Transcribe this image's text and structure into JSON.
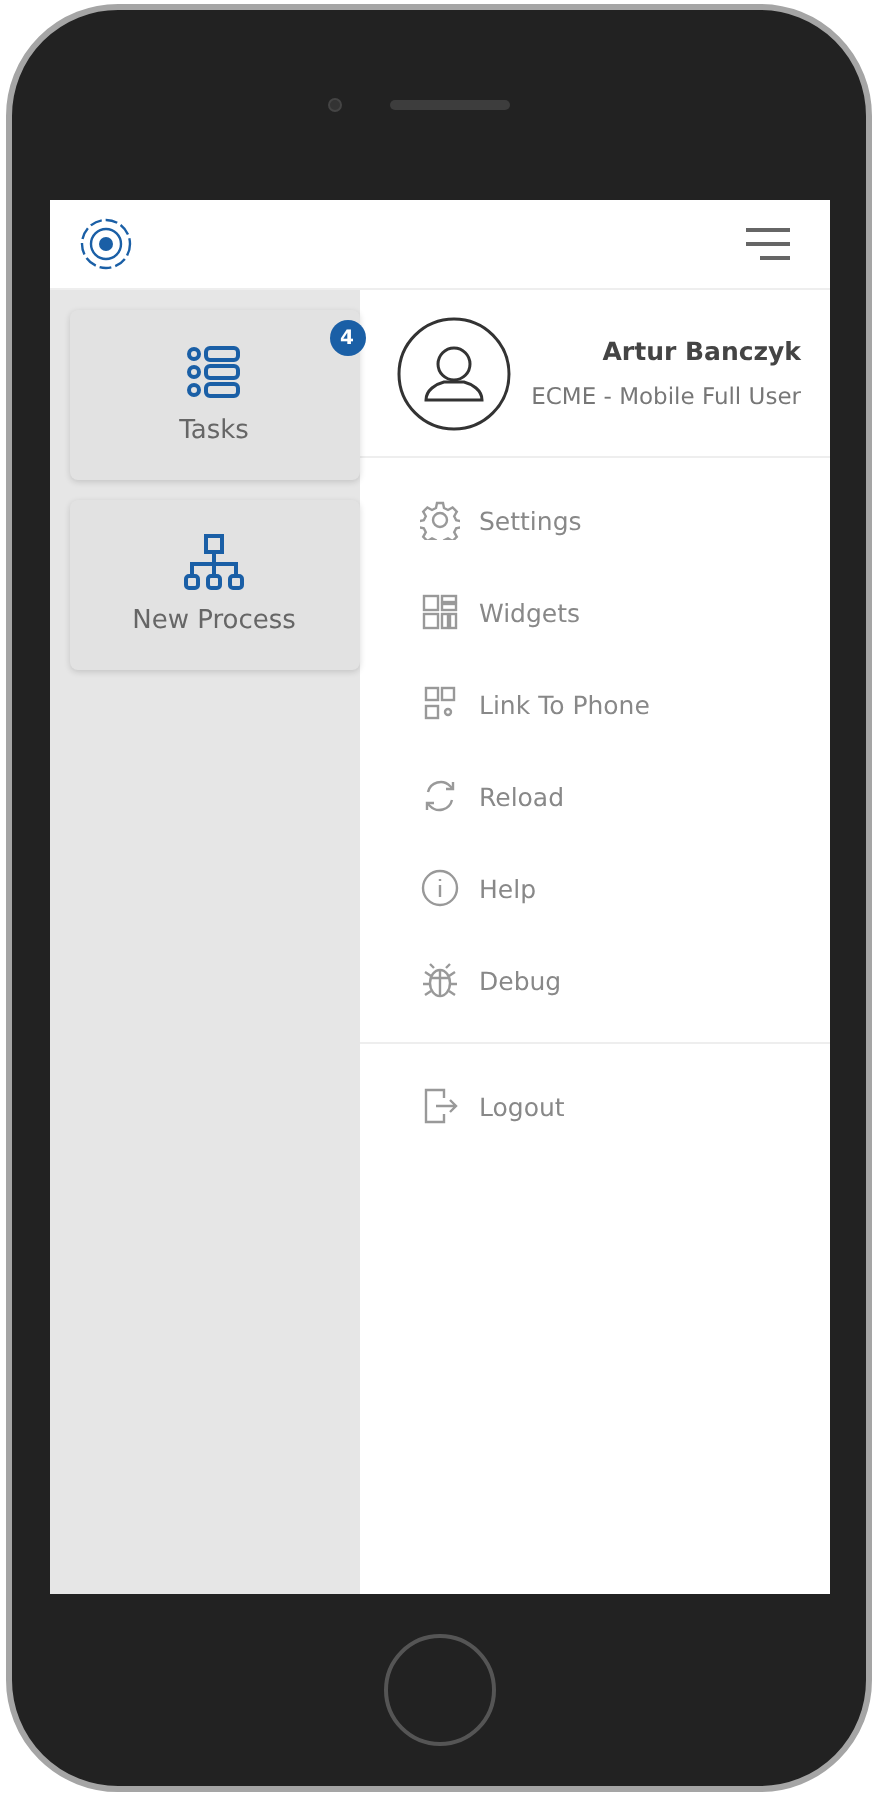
{
  "header": {
    "menu_open": true
  },
  "tiles": [
    {
      "label": "Tasks",
      "badge": "4"
    },
    {
      "label": "New Process"
    }
  ],
  "profile": {
    "name": "Artur Banczyk",
    "role": "ECME - Mobile Full User"
  },
  "menu": {
    "items": [
      {
        "label": "Settings"
      },
      {
        "label": "Widgets"
      },
      {
        "label": "Link To Phone"
      },
      {
        "label": "Reload"
      },
      {
        "label": "Help"
      },
      {
        "label": "Debug"
      }
    ],
    "footer_items": [
      {
        "label": "Logout"
      }
    ]
  }
}
